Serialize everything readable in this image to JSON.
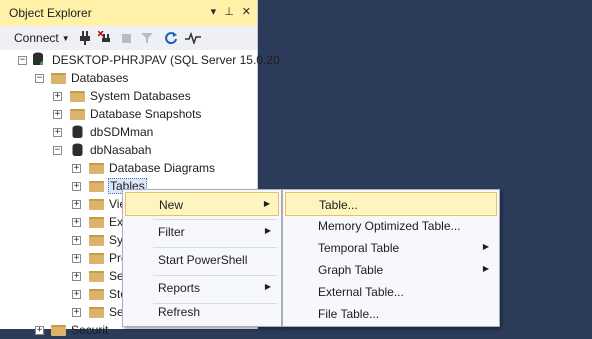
{
  "object_explorer": {
    "title": "Object Explorer",
    "pin_glyph": "▾  ⊥  ✕",
    "connect_label": "Connect",
    "tree": {
      "server": "DESKTOP-PHRJPAV (SQL Server 15.0.20",
      "databases": "Databases",
      "system_databases": "System Databases",
      "database_snapshots": "Database Snapshots",
      "db1": "dbSDMman",
      "db2": "dbNasabah",
      "database_diagrams": "Database Diagrams",
      "tables": "Tables",
      "views_partial": "Vie",
      "external_partial": "Ext",
      "synonyms_partial": "Sy",
      "programmability_partial": "Pro",
      "service_broker_partial": "Se",
      "storage_partial": "Sto",
      "security_partial": "Se",
      "security_root_partial": "Securit"
    }
  },
  "context_menu": {
    "items": [
      {
        "label": "New",
        "submenu": true
      },
      {
        "label": "Filter",
        "submenu": true
      },
      {
        "label": "Start PowerShell",
        "submenu": false
      },
      {
        "label": "Reports",
        "submenu": true
      },
      {
        "label": "Refresh",
        "submenu": false
      }
    ]
  },
  "new_submenu": {
    "items": [
      {
        "label": "Table...",
        "submenu": false
      },
      {
        "label": "Memory Optimized Table...",
        "submenu": false
      },
      {
        "label": "Temporal Table",
        "submenu": true
      },
      {
        "label": "Graph Table",
        "submenu": true
      },
      {
        "label": "External Table...",
        "submenu": false
      },
      {
        "label": "File Table...",
        "submenu": false
      }
    ]
  },
  "colors": {
    "title_bg": "#fff1a8",
    "desktop_bg": "#2c3b5a",
    "highlight": "#fdf4bf"
  }
}
